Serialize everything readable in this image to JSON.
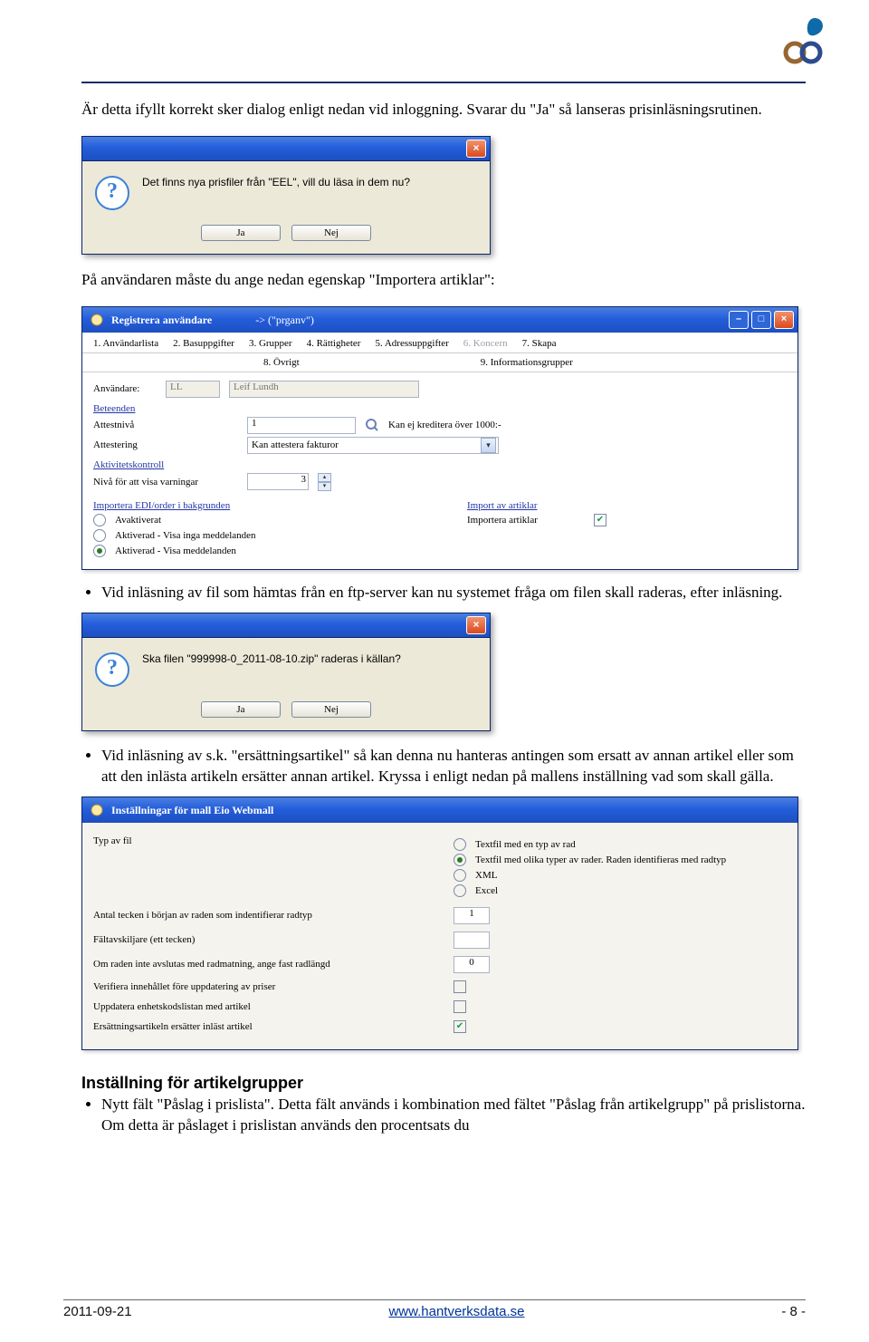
{
  "logo": {
    "alt": "Hantverksdata logo"
  },
  "para1": "Är detta ifyllt korrekt sker dialog enligt nedan vid inloggning. Svarar du \"Ja\" så lanseras prisinläsningsrutinen.",
  "dlg1": {
    "text": "Det finns nya prisfiler från \"EEL\", vill du läsa in dem nu?",
    "yes": "Ja",
    "no": "Nej"
  },
  "para2": "På användaren måste du ange nedan egenskap \"Importera artiklar\":",
  "regwin": {
    "title": "Registrera användare",
    "title_suffix": "->  (\"prganv\")",
    "tabs": [
      "1. Användarlista",
      "2. Basuppgifter",
      "3. Grupper",
      "4. Rättigheter",
      "5. Adressuppgifter",
      "6. Koncern",
      "7. Skapa"
    ],
    "tabs2": [
      "8. Övrigt",
      "9. Informationsgrupper"
    ],
    "user_lbl": "Användare:",
    "user_code": "LL",
    "user_name": "Leif Lundh",
    "sect_bet": "Beteenden",
    "attestniva": "Attestnivå",
    "attestniva_val": "1",
    "kredit_label": "Kan ej kreditera över 1000:-",
    "attestering": "Attestering",
    "attestering_val": "Kan attestera fakturor",
    "sect_akt": "Aktivitetskontroll",
    "niva_lbl": "Nivå för att visa varningar",
    "niva_val": "3",
    "sect_edi": "Importera EDI/order i bakgrunden",
    "r1": "Avaktiverat",
    "r2": "Aktiverad - Visa inga meddelanden",
    "r3": "Aktiverad - Visa meddelanden",
    "sect_imp": "Import av artiklar",
    "imp_lbl": "Importera artiklar"
  },
  "bullet1": "Vid inläsning av fil som hämtas från en ftp-server kan nu systemet fråga om filen skall raderas, efter inläsning.",
  "dlg2": {
    "text": "Ska filen \"999998-0_2011-08-10.zip\" raderas i källan?",
    "yes": "Ja",
    "no": "Nej"
  },
  "bullet2": "Vid inläsning av s.k. \"ersättningsartikel\" så kan denna nu hanteras antingen som ersatt av annan artikel eller som att den inlästa artikeln ersätter annan artikel. Kryssa i enligt nedan på mallens inställning vad som skall gälla.",
  "setswin": {
    "title": "Inställningar för mall Eio Webmall",
    "typ_lbl": "Typ av fil",
    "typ_opts": [
      "Textfil med en typ av rad",
      "Textfil med olika typer av rader. Raden identifieras med radtyp",
      "XML",
      "Excel"
    ],
    "antal_lbl": "Antal tecken i början av raden som indentifierar radtyp",
    "antal_val": "1",
    "faltav_lbl": "Fältavskiljare (ett tecken)",
    "radl_lbl": "Om raden inte avslutas med radmatning, ange fast radlängd",
    "radl_val": "0",
    "verif_lbl": "Verifiera innehållet före uppdatering av priser",
    "uppd_lbl": "Uppdatera enhetskodslistan med artikel",
    "ers_lbl": "Ersättningsartikeln ersätter inläst artikel"
  },
  "heading2": "Inställning för artikelgrupper",
  "bullet3": "Nytt fält \"Påslag i prislista\". Detta fält används i kombination med fältet \"Påslag från artikelgrupp\" på prislistorna. Om detta är påslaget i prislistan används den procentsats du",
  "footer": {
    "date": "2011-09-21",
    "url": "www.hantverksdata.se",
    "page": "- 8 -"
  }
}
